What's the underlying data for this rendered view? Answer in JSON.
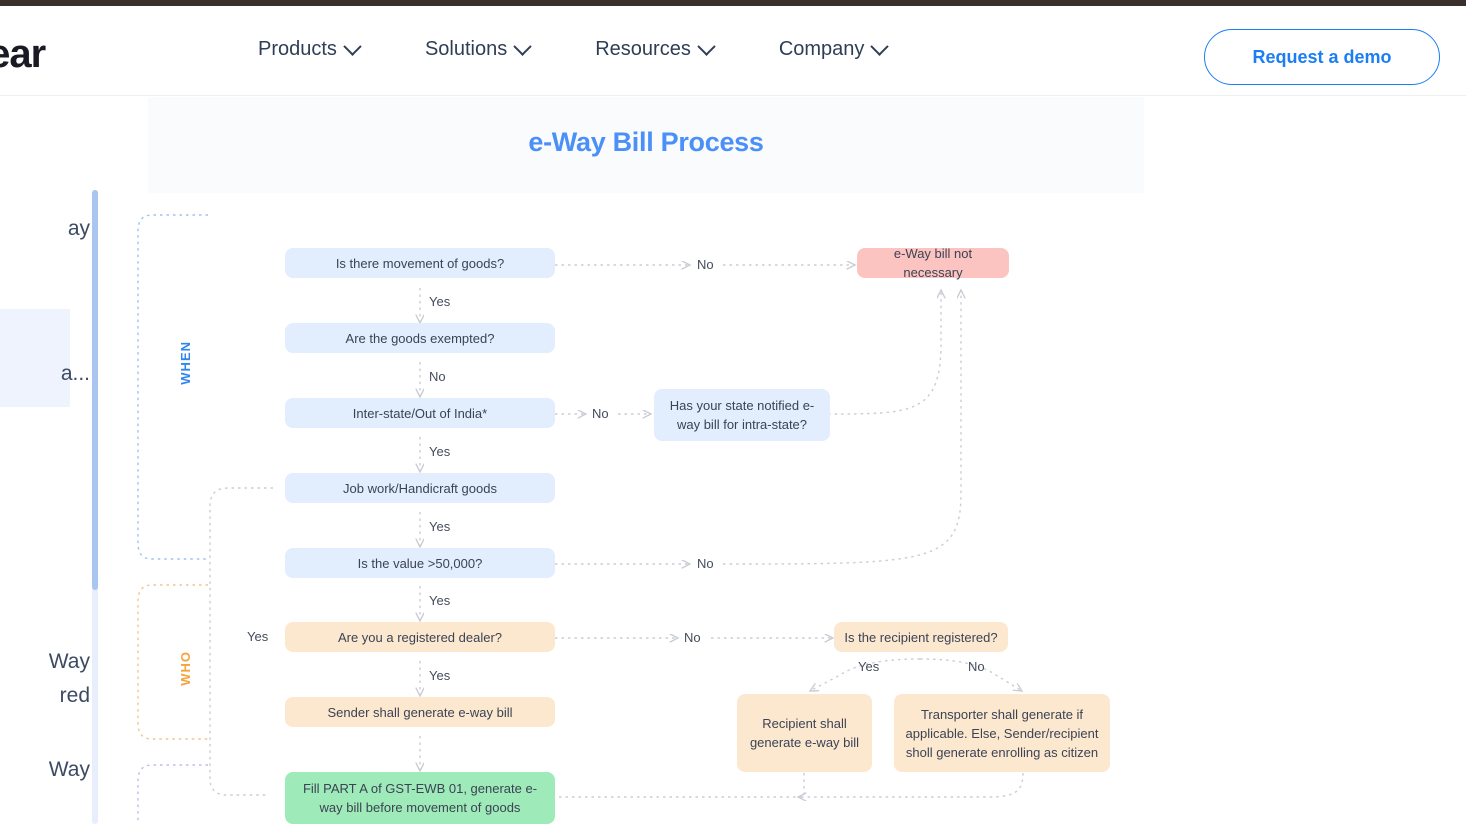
{
  "topbar": {
    "color": "#3b2f2c"
  },
  "header": {
    "logo": "lear",
    "nav": [
      {
        "label": "Products"
      },
      {
        "label": "Solutions"
      },
      {
        "label": "Resources"
      },
      {
        "label": "Company"
      }
    ],
    "cta": "Request a demo"
  },
  "sidebar": {
    "items": [
      {
        "label": "ay"
      },
      {
        "label": "a..."
      },
      {
        "label": "Way"
      },
      {
        "label": "red"
      },
      {
        "label": "Way"
      }
    ]
  },
  "content": {
    "title": "e-Way Bill Process"
  },
  "chart_data": {
    "type": "diagram",
    "title": "e-Way Bill Process",
    "sections": [
      {
        "id": "when",
        "label": "WHEN",
        "color": "#2f86ef"
      },
      {
        "id": "who",
        "label": "WHO",
        "color": "#f5a33c"
      }
    ],
    "nodes": [
      {
        "id": "n1",
        "text": "Is there movement of goods?",
        "style": "blue"
      },
      {
        "id": "n2",
        "text": "e-Way bill not necessary",
        "style": "pink"
      },
      {
        "id": "n3",
        "text": "Are the goods exempted?",
        "style": "blue"
      },
      {
        "id": "n4",
        "text": "Inter-state/Out of India*",
        "style": "blue"
      },
      {
        "id": "n5",
        "text": "Has your state notified\ne-way bill for intra-state?",
        "style": "blue"
      },
      {
        "id": "n6",
        "text": "Job work/Handicraft goods",
        "style": "blue"
      },
      {
        "id": "n7",
        "text": "Is the value >50,000?",
        "style": "blue"
      },
      {
        "id": "n8",
        "text": "Are you a registered dealer?",
        "style": "peach"
      },
      {
        "id": "n9",
        "text": "Is the recipient registered?",
        "style": "peach"
      },
      {
        "id": "n10",
        "text": "Sender shall generate e-way bill",
        "style": "peach"
      },
      {
        "id": "n11",
        "text": "Recipient shall\ngenerate e-way bill",
        "style": "peach"
      },
      {
        "id": "n12",
        "text": "Transporter shall generate if\napplicable. Else, Sender/recipient\nsholl generate enrolling as citizen",
        "style": "peach"
      },
      {
        "id": "n13",
        "text": "Fill PART A of GST-EWB 01, generate\ne-way bill before movement of goods",
        "style": "green"
      }
    ],
    "edge_labels": [
      {
        "id": "e1",
        "text": "No"
      },
      {
        "id": "e2",
        "text": "Yes"
      },
      {
        "id": "e3",
        "text": "No"
      },
      {
        "id": "e4",
        "text": "No"
      },
      {
        "id": "e5",
        "text": "Yes"
      },
      {
        "id": "e6",
        "text": "Yes"
      },
      {
        "id": "e7",
        "text": "No"
      },
      {
        "id": "e8",
        "text": "Yes"
      },
      {
        "id": "e9",
        "text": "No"
      },
      {
        "id": "e10",
        "text": "Yes"
      },
      {
        "id": "e11",
        "text": "Yes"
      },
      {
        "id": "e12",
        "text": "No"
      }
    ]
  }
}
